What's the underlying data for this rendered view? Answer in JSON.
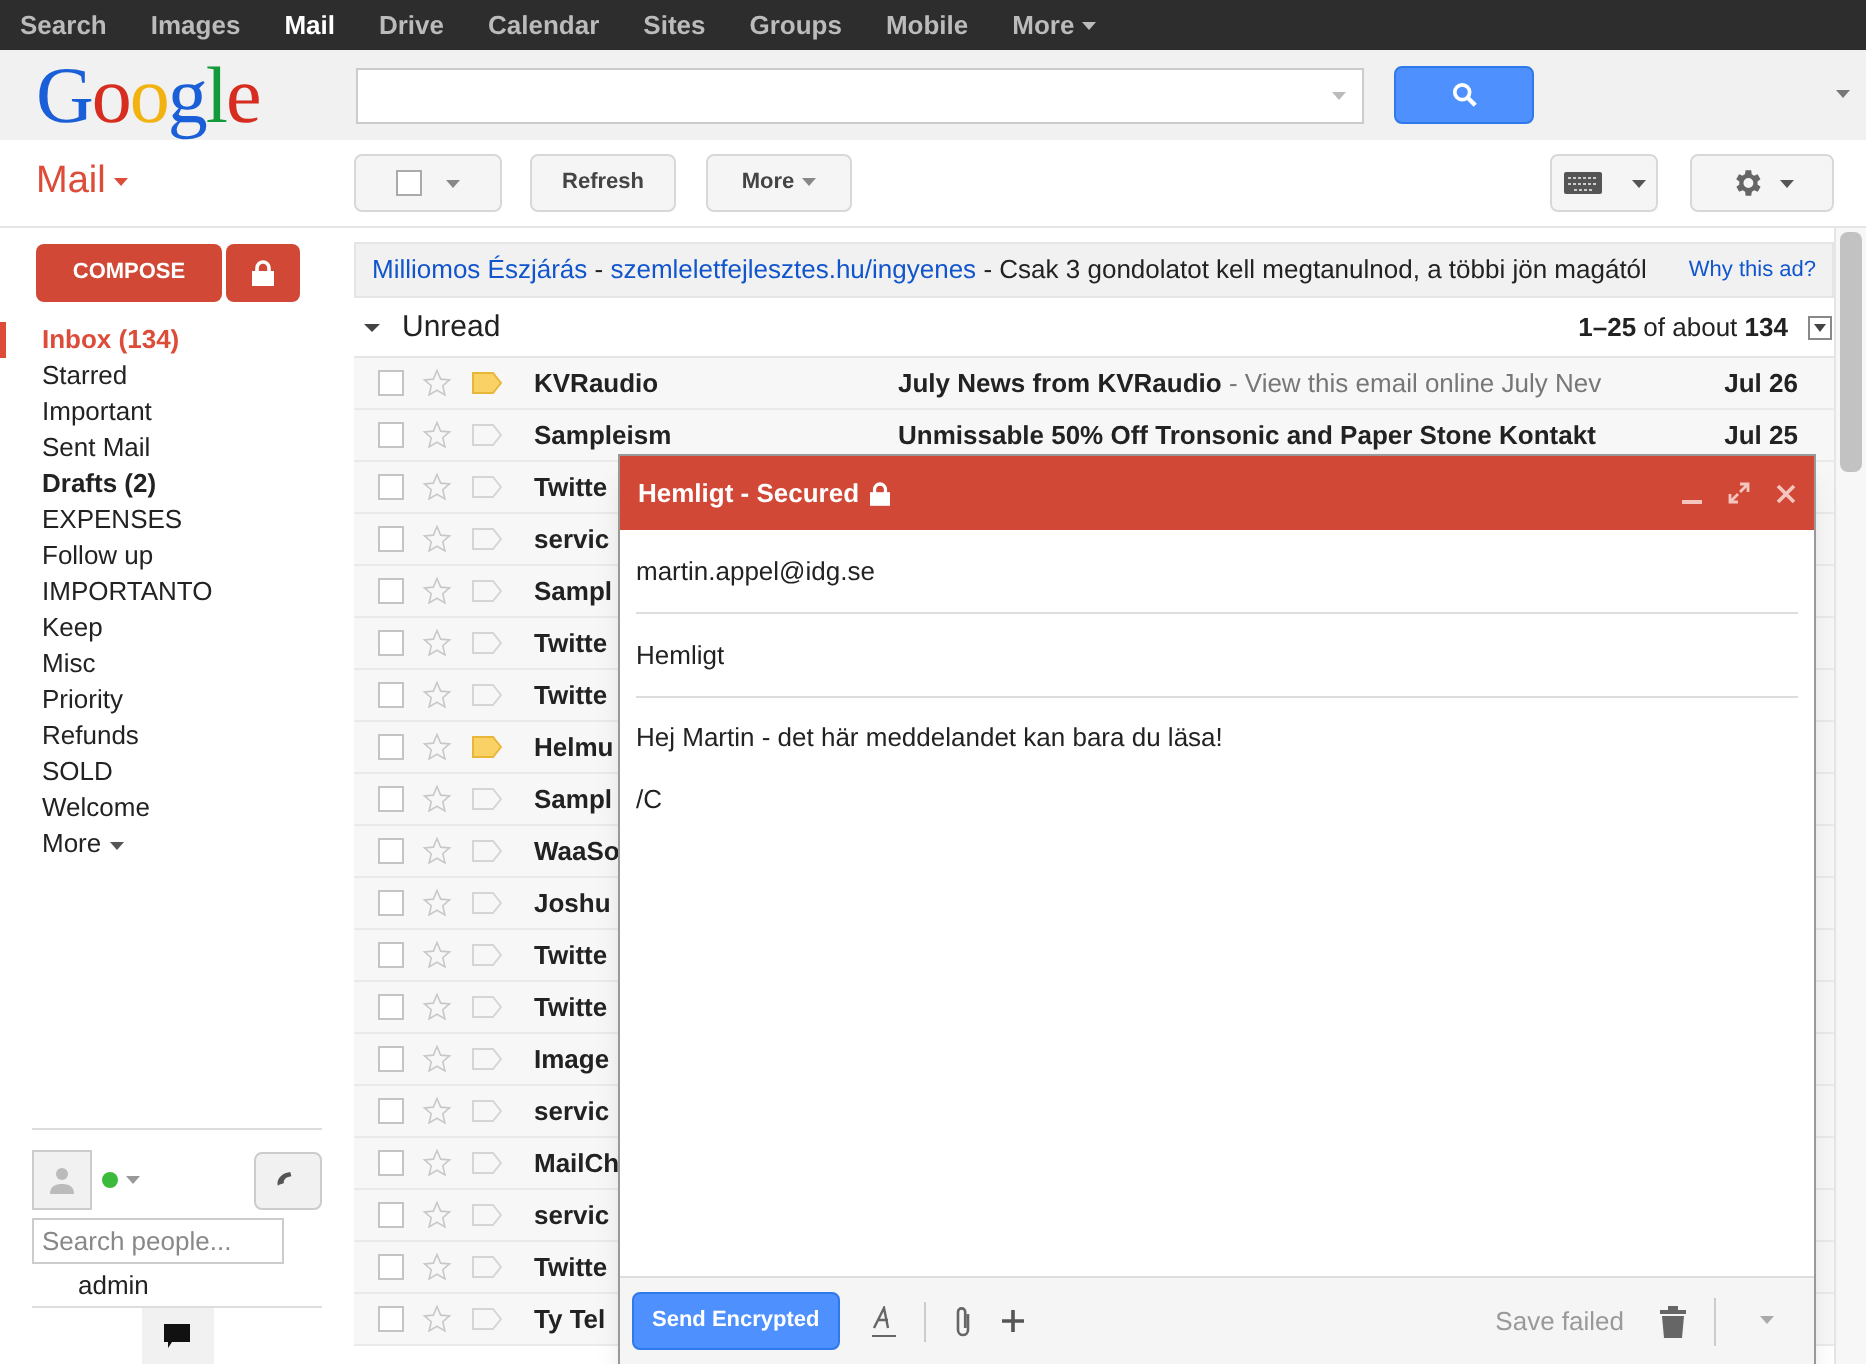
{
  "topbar": [
    {
      "label": "Search",
      "selected": false
    },
    {
      "label": "Images",
      "selected": false
    },
    {
      "label": "Mail",
      "selected": true
    },
    {
      "label": "Drive",
      "selected": false
    },
    {
      "label": "Calendar",
      "selected": false
    },
    {
      "label": "Sites",
      "selected": false
    },
    {
      "label": "Groups",
      "selected": false
    },
    {
      "label": "Mobile",
      "selected": false
    },
    {
      "label": "More",
      "selected": false,
      "menu": true
    }
  ],
  "logo": "Google",
  "mail_menu": "Mail",
  "toolbar": {
    "refresh": "Refresh",
    "more": "More"
  },
  "compose_button": "COMPOSE",
  "labels": [
    {
      "label": "Inbox (134)",
      "selected": true,
      "unread": true
    },
    {
      "label": "Starred",
      "selected": false,
      "unread": false
    },
    {
      "label": "Important",
      "selected": false,
      "unread": false
    },
    {
      "label": "Sent Mail",
      "selected": false,
      "unread": false
    },
    {
      "label": "Drafts (2)",
      "selected": false,
      "unread": true
    },
    {
      "label": "EXPENSES",
      "selected": false,
      "unread": false
    },
    {
      "label": "Follow up",
      "selected": false,
      "unread": false
    },
    {
      "label": "IMPORTANTO",
      "selected": false,
      "unread": false
    },
    {
      "label": "Keep",
      "selected": false,
      "unread": false
    },
    {
      "label": "Misc",
      "selected": false,
      "unread": false
    },
    {
      "label": "Priority",
      "selected": false,
      "unread": false
    },
    {
      "label": "Refunds",
      "selected": false,
      "unread": false
    },
    {
      "label": "SOLD",
      "selected": false,
      "unread": false
    },
    {
      "label": "Welcome",
      "selected": false,
      "unread": false
    }
  ],
  "labels_more": "More",
  "ad": {
    "separator": "-",
    "title": "Milliomos Észjárás",
    "url": "szemleletfejlesztes.hu/ingyenes",
    "text": "Csak 3 gondolatot kell megtanulnod, a többi jön magától",
    "why": "Why this ad?"
  },
  "section": {
    "title": "Unread",
    "expanded": true,
    "range": "1–25",
    "of": "of about",
    "total": "134"
  },
  "emails": [
    {
      "sender": "KVRaudio",
      "subject": "July News from KVRaudio",
      "snippet": "- View this email online July Nev",
      "date": "Jul 26",
      "important": true,
      "checked": false
    },
    {
      "sender": "Sampleism",
      "subject": "Unmissable 50% Off Tronsonic and Paper Stone Kontakt",
      "date": "Jul 25",
      "important": false,
      "checked": false
    },
    {
      "sender": "Twitte",
      "important": false,
      "checked": false
    },
    {
      "sender": "servic",
      "important": false,
      "checked": false
    },
    {
      "sender": "Sampl",
      "important": false,
      "checked": false
    },
    {
      "sender": "Twitte",
      "important": false,
      "checked": false
    },
    {
      "sender": "Twitte",
      "important": false,
      "checked": false
    },
    {
      "sender": "Helmu",
      "important": true,
      "checked": false
    },
    {
      "sender": "Sampl",
      "important": false,
      "checked": false
    },
    {
      "sender": "WaaSo",
      "important": false,
      "checked": false
    },
    {
      "sender": "Joshu",
      "important": false,
      "checked": false
    },
    {
      "sender": "Twitte",
      "important": false,
      "checked": false
    },
    {
      "sender": "Twitte",
      "important": false,
      "checked": false
    },
    {
      "sender": "Image",
      "important": false,
      "checked": false
    },
    {
      "sender": "servic",
      "important": false,
      "checked": false
    },
    {
      "sender": "MailCh",
      "important": false,
      "checked": false
    },
    {
      "sender": "servic",
      "important": false,
      "checked": false
    },
    {
      "sender": "Twitte",
      "important": false,
      "checked": false
    },
    {
      "sender": "Ty Tel",
      "important": false,
      "checked": false
    }
  ],
  "chat": {
    "online": true,
    "search_placeholder": "Search people...",
    "contacts": [
      "admin"
    ]
  },
  "compose": {
    "title": "Hemligt - Secured",
    "to": "martin.appel@idg.se",
    "subject": "Hemligt",
    "body": [
      "Hej Martin - det här meddelandet kan bara du läsa!",
      "/C"
    ],
    "send": "Send Encrypted",
    "status": "Save failed"
  }
}
